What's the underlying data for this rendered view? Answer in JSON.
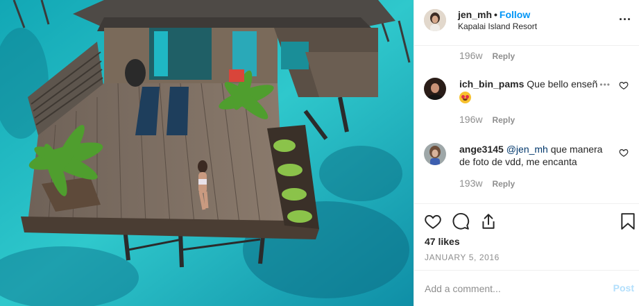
{
  "post": {
    "username": "jen_mh",
    "separator": "•",
    "follow_label": "Follow",
    "location": "Kapalai Island Resort",
    "more_label": "..."
  },
  "comments": [
    {
      "time": "196w",
      "reply_label": "Reply"
    },
    {
      "username": "ich_bin_pams",
      "text": "Que bello enseño",
      "emoji": "heart-eyes-emoji",
      "time": "196w",
      "reply_label": "Reply"
    },
    {
      "username": "ange3145",
      "mention": "@jen_mh",
      "text": " que manera de foto de vdd, me encanta",
      "time": "193w",
      "reply_label": "Reply"
    }
  ],
  "actions": {
    "likes": "47 likes",
    "date": "JANUARY 5, 2016",
    "icons": [
      "heart-icon",
      "comment-icon",
      "share-icon",
      "bookmark-icon"
    ]
  },
  "comment_box": {
    "placeholder": "Add a comment...",
    "post_label": "Post"
  },
  "colors": {
    "link": "#0095f6",
    "muted": "#8e8e8e",
    "post_disabled": "#b2dffc",
    "water": "#1fb9c2"
  }
}
